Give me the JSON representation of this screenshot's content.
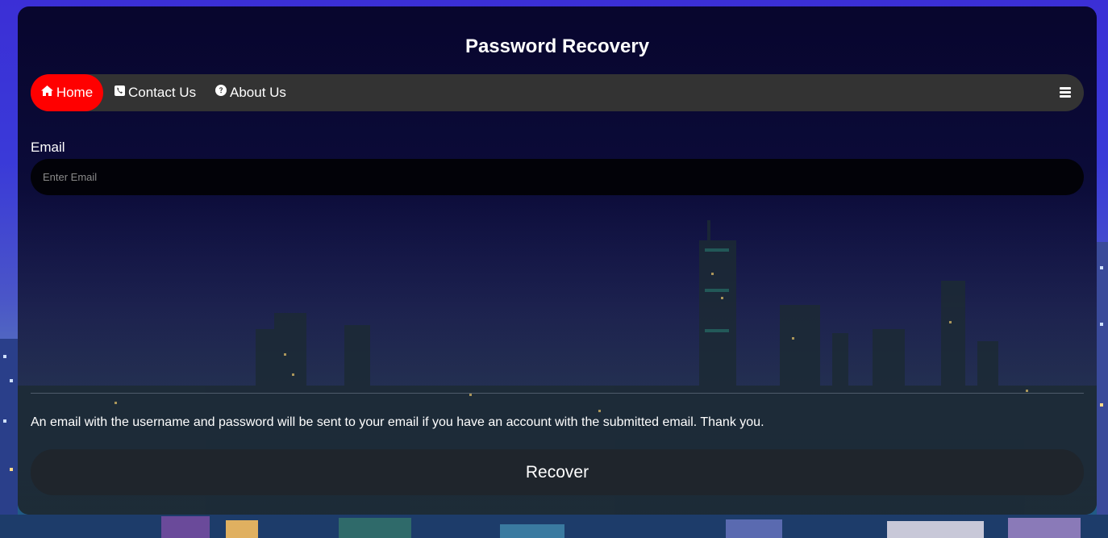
{
  "page": {
    "title": "Password Recovery"
  },
  "nav": {
    "items": [
      {
        "label": "Home",
        "icon": "home-icon",
        "active": true
      },
      {
        "label": "Contact Us",
        "icon": "phone-icon",
        "active": false
      },
      {
        "label": "About Us",
        "icon": "question-circle-icon",
        "active": false
      }
    ],
    "menu_icon": "hamburger-menu-icon"
  },
  "form": {
    "email_label": "Email",
    "email_placeholder": "Enter Email",
    "email_value": "",
    "notice": "An email with the username and password will be sent to your email if you have an account with the submitted email. Thank you.",
    "submit_label": "Recover"
  },
  "colors": {
    "accent": "#ff0000",
    "navbar_bg": "#333333",
    "button_bg": "#1f252c",
    "input_bg": "#020208"
  }
}
